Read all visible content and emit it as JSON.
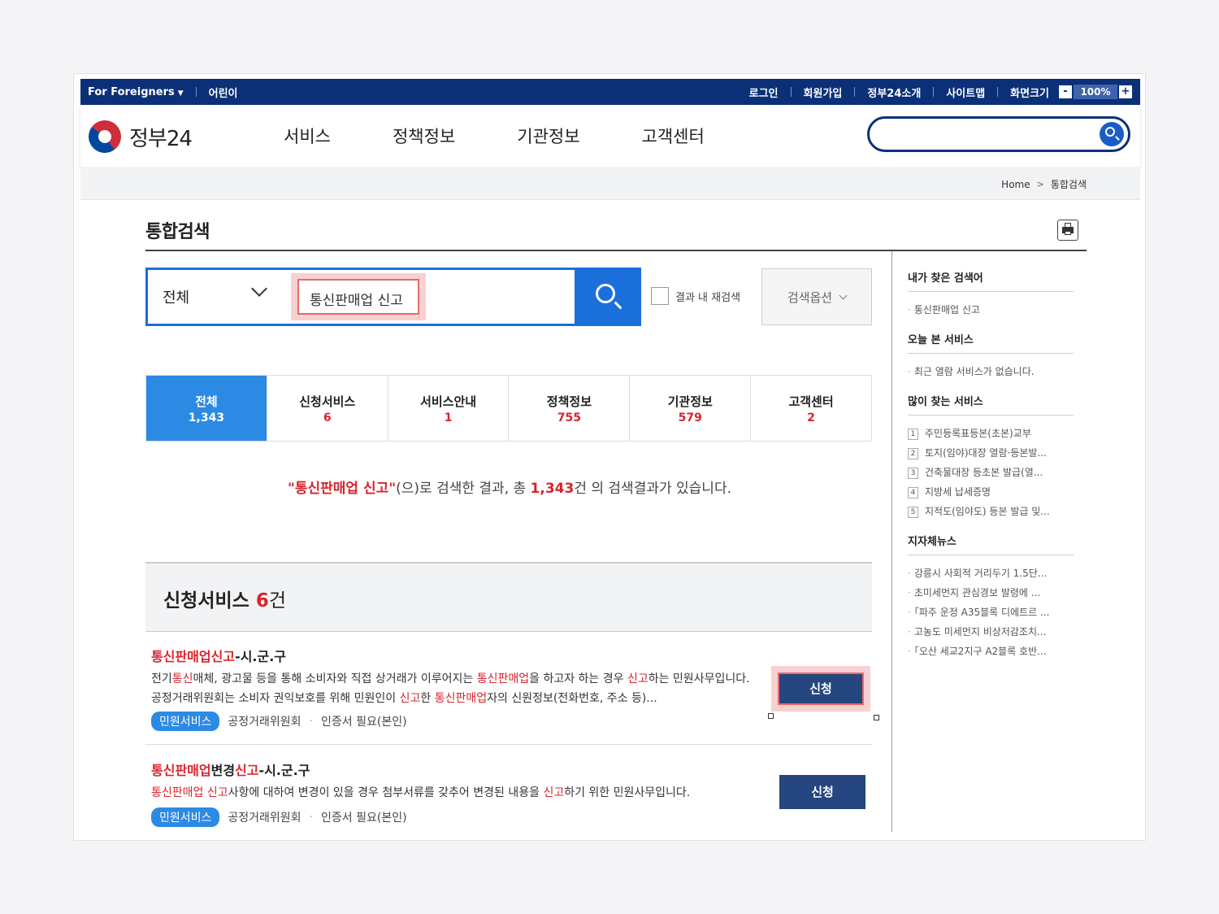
{
  "topbar": {
    "foreigners": "For Foreigners",
    "kids": "어린이",
    "login": "로그인",
    "signup": "회원가입",
    "intro": "정부24소개",
    "sitemap": "사이트맵",
    "font_size": "화면크기",
    "zoom_minus": "-",
    "zoom_value": "100%",
    "zoom_plus": "+"
  },
  "header": {
    "logo": "정부24",
    "nav": [
      "서비스",
      "정책정보",
      "기관정보",
      "고객센터"
    ],
    "search_value": ""
  },
  "breadcrumb": {
    "home": "Home",
    "current": "통합검색"
  },
  "page": {
    "title": "통합검색"
  },
  "search": {
    "category": "전체",
    "query": "통신판매업 신고",
    "recheck_label": "결과 내 재검색",
    "options_label": "검색옵션"
  },
  "tabs": [
    {
      "label": "전체",
      "count": "1,343"
    },
    {
      "label": "신청서비스",
      "count": "6"
    },
    {
      "label": "서비스안내",
      "count": "1"
    },
    {
      "label": "정책정보",
      "count": "755"
    },
    {
      "label": "기관정보",
      "count": "579"
    },
    {
      "label": "고객센터",
      "count": "2"
    }
  ],
  "summary": {
    "query_quoted": "\"통신판매업 신고\"",
    "mid": "(으)로 검색한 결과, 총 ",
    "total": "1,343",
    "tail": "건 의 검색결과가 있습니다."
  },
  "section": {
    "title": "신청서비스 ",
    "count": "6",
    "unit": "건"
  },
  "services": [
    {
      "title_hl": "통신판매업신고",
      "title_rest": "-시.군.구",
      "desc_parts": [
        {
          "t": "전기",
          "hl": false
        },
        {
          "t": "통신",
          "hl": true
        },
        {
          "t": "매체, 광고물 등을 통해 소비자와 직접 상거래가 이루어지는 ",
          "hl": false
        },
        {
          "t": "통신판매업",
          "hl": true
        },
        {
          "t": "을 하고자 하는 경우 ",
          "hl": false
        },
        {
          "t": "신고",
          "hl": true
        },
        {
          "t": "하는 민원사무입니다. 공정거래위원회는 소비자 권익보호를 위해 민원인이 ",
          "hl": false
        },
        {
          "t": "신고",
          "hl": true
        },
        {
          "t": "한 ",
          "hl": false
        },
        {
          "t": "통신판매업",
          "hl": true
        },
        {
          "t": "자의 신원정보(전화번호, 주소 등)...",
          "hl": false
        }
      ],
      "badge": "민원서비스",
      "agency": "공정거래위원회",
      "cert": "인증서 필요(본인)",
      "button": "신청"
    },
    {
      "title_hl1": "통신판매업",
      "title_mid": "변경",
      "title_hl2": "신고",
      "title_rest": "-시.군.구",
      "desc_parts": [
        {
          "t": "통신판매업 신고",
          "hl": true
        },
        {
          "t": "사항에 대하여 변경이 있을 경우 첨부서류를 갖추어 변경된 내용을 ",
          "hl": false
        },
        {
          "t": "신고",
          "hl": true
        },
        {
          "t": "하기 위한 민원사무입니다.",
          "hl": false
        }
      ],
      "badge": "민원서비스",
      "agency": "공정거래위원회",
      "cert": "인증서 필요(본인)",
      "button": "신청"
    }
  ],
  "sidebar": {
    "my_keywords_title": "내가 찾은 검색어",
    "my_keywords": [
      "통신판매업 신고"
    ],
    "viewed_title": "오늘 본 서비스",
    "viewed_empty": "최근 열람 서비스가 없습니다.",
    "popular_title": "많이 찾는 서비스",
    "popular": [
      {
        "rank": "1",
        "label": "주민등록표등본(초본)교부"
      },
      {
        "rank": "2",
        "label": "토지(임야)대장 열람·등본발..."
      },
      {
        "rank": "3",
        "label": "건축물대장 등초본 발급(열..."
      },
      {
        "rank": "4",
        "label": "지방세 납세증명"
      },
      {
        "rank": "5",
        "label": "지적도(임야도) 등본 발급 및..."
      }
    ],
    "news_title": "지자체뉴스",
    "news": [
      "강릉시 사회적 거리두기 1.5단...",
      "초미세먼지 관심경보 발령에 ...",
      "「파주 운정 A35블록 디에트르 ...",
      "고농도 미세먼지 비상저감조치...",
      "「오산 세교2지구 A2블록 호반..."
    ]
  },
  "colors": {
    "navy": "#0b3077",
    "accent_blue": "#1a6fdb",
    "highlight_red": "#d9242c",
    "button_navy": "#25467f"
  }
}
